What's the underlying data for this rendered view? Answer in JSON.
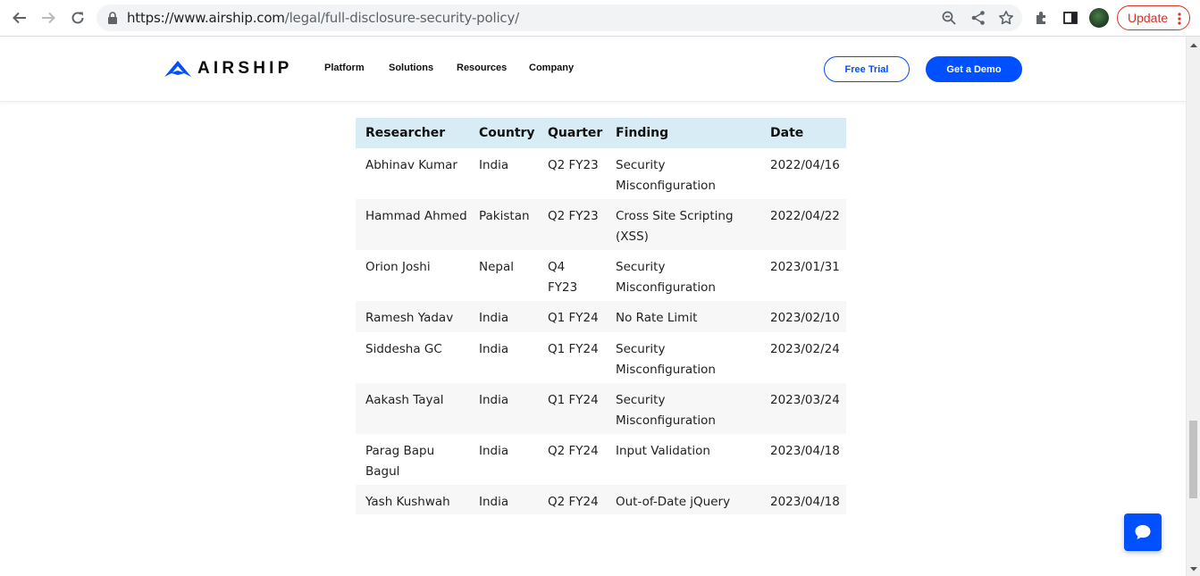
{
  "browser": {
    "url_host": "https://www.airship.com",
    "url_path": "/legal/full-disclosure-security-policy/",
    "update_label": "Update"
  },
  "header": {
    "logo_text": "AIRSHIP",
    "menu": [
      "Platform",
      "Solutions",
      "Resources",
      "Company"
    ],
    "free_trial": "Free Trial",
    "get_demo": "Get a Demo",
    "brand_color": "#0050ff"
  },
  "table": {
    "columns": [
      "Researcher",
      "Country",
      "Quarter",
      "Finding",
      "Date"
    ],
    "rows": [
      {
        "researcher": "Abhinav Kumar",
        "country": "India",
        "quarter": "Q2 FY23",
        "finding": "Security Misconfiguration",
        "date": "2022/04/16"
      },
      {
        "researcher": "Hammad Ahmed",
        "country": "Pakistan",
        "quarter": "Q2 FY23",
        "finding": "Cross Site Scripting (XSS)",
        "date": "2022/04/22"
      },
      {
        "researcher": "Orion Joshi",
        "country": "Nepal",
        "quarter": "Q4 FY23",
        "finding": "Security Misconfiguration",
        "date": "2023/01/31"
      },
      {
        "researcher": "Ramesh Yadav",
        "country": "India",
        "quarter": "Q1 FY24",
        "finding": "No Rate Limit",
        "date": "2023/02/10"
      },
      {
        "researcher": "Siddesha GC",
        "country": "India",
        "quarter": "Q1 FY24",
        "finding": "Security Misconfiguration",
        "date": "2023/02/24"
      },
      {
        "researcher": "Aakash Tayal",
        "country": "India",
        "quarter": "Q1 FY24",
        "finding": "Security Misconfiguration",
        "date": "2023/03/24"
      },
      {
        "researcher": "Parag Bapu Bagul",
        "country": "India",
        "quarter": "Q2 FY24",
        "finding": "Input Validation",
        "date": "2023/04/18"
      },
      {
        "researcher": "Yash Kushwah",
        "country": "India",
        "quarter": "Q2 FY24",
        "finding": "Out-of-Date jQuery",
        "date": "2023/04/18"
      }
    ]
  }
}
